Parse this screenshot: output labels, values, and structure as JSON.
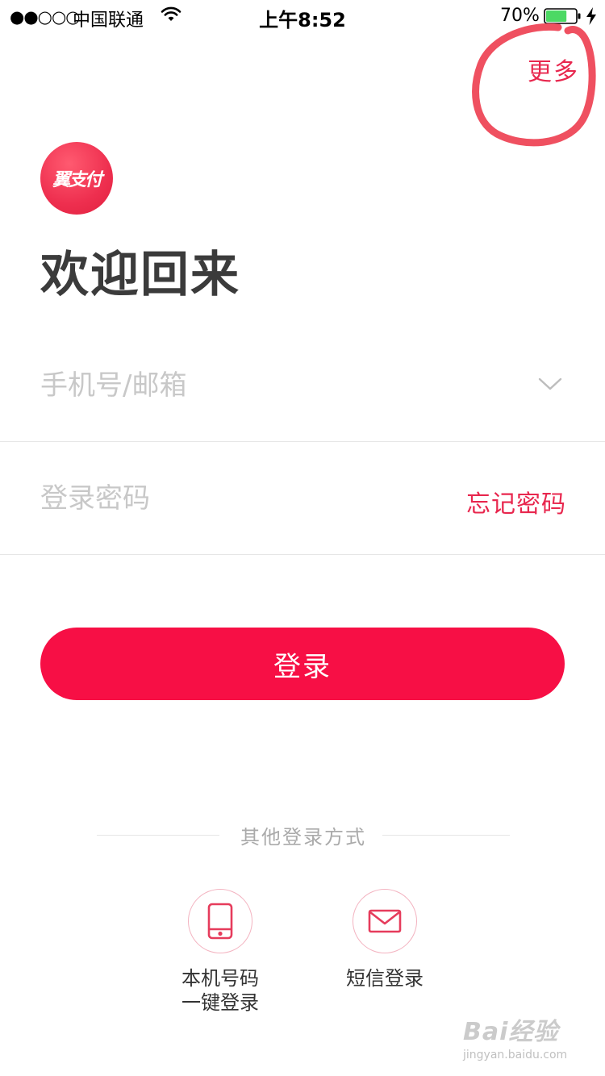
{
  "status_bar": {
    "signal": "●●○○○",
    "carrier": "中国联通",
    "time": "上午8:52",
    "battery_percent": "70%",
    "battery_level": 0.7
  },
  "header": {
    "more_label": "更多"
  },
  "logo": {
    "text": "翼支付",
    "accent_color": "#ee2f4f"
  },
  "welcome_title": "欢迎回来",
  "account_input": {
    "placeholder": "手机号/邮箱",
    "value": ""
  },
  "password_input": {
    "placeholder": "登录密码",
    "value": ""
  },
  "forgot_password_label": "忘记密码",
  "login_button_label": "登录",
  "other_methods": {
    "title": "其他登录方式",
    "phone": {
      "icon": "phone-icon",
      "label_line1": "本机号码",
      "label_line2": "一键登录"
    },
    "sms": {
      "icon": "mail-icon",
      "label": "短信登录"
    }
  },
  "watermark": {
    "title": "Bai经验",
    "subtitle": "jingyan.baidu.com"
  },
  "colors": {
    "brand_red": "#f70f45",
    "link_red": "#e8274e",
    "annotation_red": "#ef5060"
  }
}
